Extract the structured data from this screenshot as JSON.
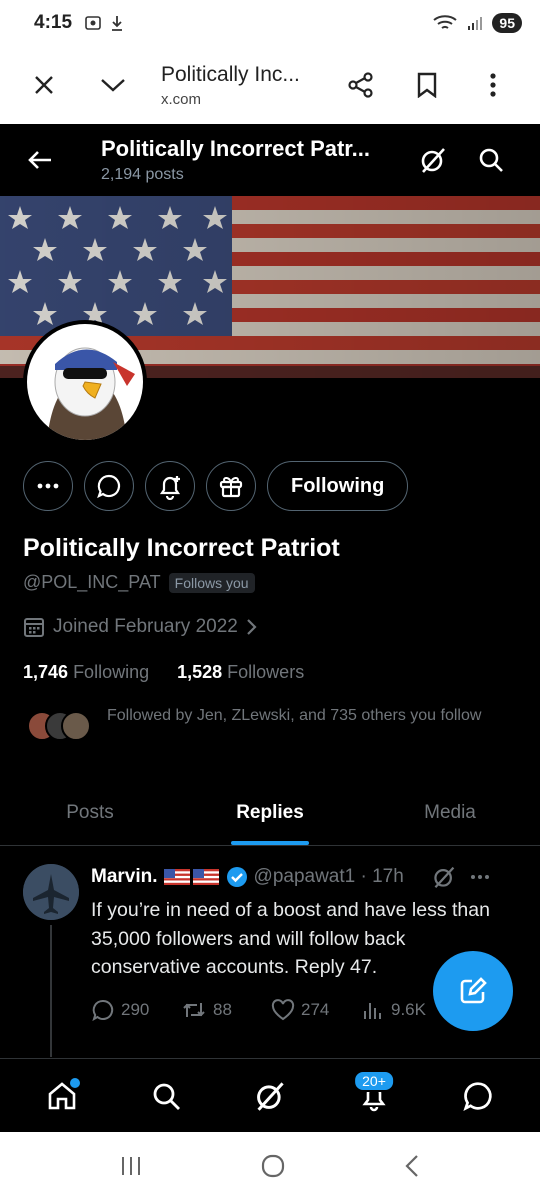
{
  "status_bar": {
    "time": "4:15",
    "battery": "95"
  },
  "browser": {
    "page_title": "Politically Inc...",
    "domain": "x.com"
  },
  "header": {
    "name": "Politically Incorrect Patr...",
    "posts": "2,194 posts"
  },
  "profile": {
    "following_button": "Following",
    "name": "Politically Incorrect Patriot",
    "handle": "@POL_INC_PAT",
    "follows_you": "Follows you",
    "joined": "Joined February 2022",
    "following_count": "1,746",
    "following_label": "Following",
    "followers_count": "1,528",
    "followers_label": "Followers",
    "followed_by": "Followed by Jen, ZLewski, and 735 others you follow"
  },
  "tabs": [
    {
      "label": "Posts",
      "active": false
    },
    {
      "label": "Replies",
      "active": true
    },
    {
      "label": "Media",
      "active": false
    }
  ],
  "tweet": {
    "author": "Marvin.",
    "handle_time": "@papawat1 · 17h",
    "text": "If you’re in need of a boost and have less than 35,000 followers and will follow back conservative accounts. Reply 47.",
    "replies": "290",
    "reposts": "88",
    "likes": "274",
    "views": "9.6K"
  },
  "bottom_nav": {
    "notifications_badge": "20+"
  },
  "colors": {
    "accent": "#1d9bf0",
    "background": "#000000",
    "muted": "#71767b"
  },
  "icons": [
    "back-arrow-icon",
    "grok-icon",
    "search-icon",
    "more-icon",
    "message-icon",
    "notification-add-icon",
    "gift-icon",
    "calendar-icon",
    "verified-icon",
    "reply-icon",
    "repost-icon",
    "like-icon",
    "views-icon",
    "compose-icon",
    "home-icon",
    "bell-icon"
  ]
}
